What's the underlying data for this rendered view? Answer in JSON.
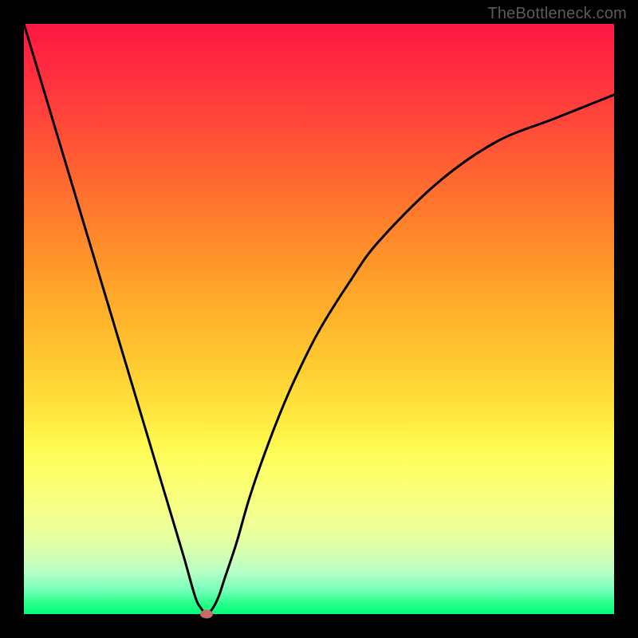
{
  "watermark": "TheBottleneck.com",
  "colors": {
    "frame": "#000000",
    "curve": "#000000",
    "marker": "#c96b62",
    "watermark": "#5b5b5b"
  },
  "chart_data": {
    "type": "line",
    "title": "",
    "xlabel": "",
    "ylabel": "",
    "xlim": [
      0,
      100
    ],
    "ylim": [
      0,
      100
    ],
    "grid": false,
    "series": [
      {
        "name": "bottleneck-curve",
        "x": [
          0,
          3,
          6,
          9,
          12,
          15,
          18,
          21,
          24,
          27,
          29,
          30,
          31,
          32,
          33,
          34,
          36,
          38,
          40,
          43,
          46,
          50,
          55,
          60,
          70,
          80,
          90,
          100
        ],
        "values": [
          100,
          90,
          80,
          70,
          60,
          50,
          40,
          30,
          20,
          10,
          3,
          1,
          0,
          1,
          3,
          6,
          12,
          19,
          25,
          33,
          40,
          48,
          56,
          63,
          73,
          80,
          84,
          88
        ]
      }
    ],
    "annotations": [
      {
        "name": "min-marker",
        "x": 31,
        "y": 0,
        "color": "#c96b62"
      }
    ]
  }
}
